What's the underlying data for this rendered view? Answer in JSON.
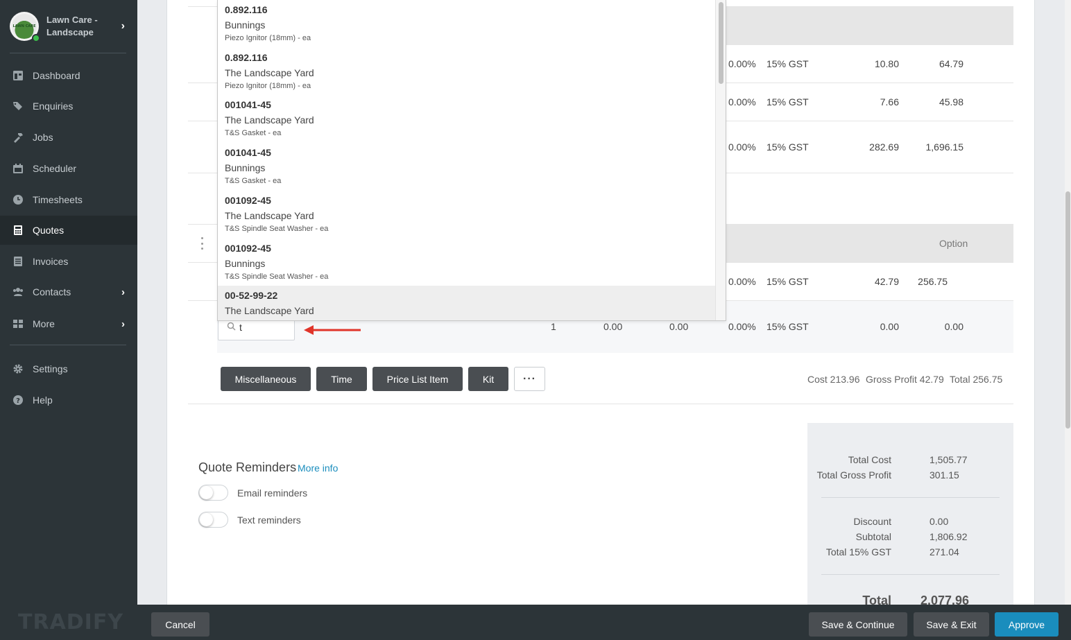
{
  "sidebar": {
    "brand": "Lawn Care - Landscape",
    "logo_text": "LAWN CARE",
    "items": [
      {
        "label": "Dashboard",
        "icon": "dashboard-icon"
      },
      {
        "label": "Enquiries",
        "icon": "tags-icon"
      },
      {
        "label": "Jobs",
        "icon": "hammer-icon"
      },
      {
        "label": "Scheduler",
        "icon": "calendar-icon"
      },
      {
        "label": "Timesheets",
        "icon": "clock-icon"
      },
      {
        "label": "Quotes",
        "icon": "calculator-icon",
        "active": true
      },
      {
        "label": "Invoices",
        "icon": "invoice-icon"
      },
      {
        "label": "Contacts",
        "icon": "users-icon"
      },
      {
        "label": "More",
        "icon": "grid-icon"
      },
      {
        "label": "Settings",
        "icon": "gear-icon"
      },
      {
        "label": "Help",
        "icon": "help-icon"
      }
    ],
    "footer_logo": "TRADIFY"
  },
  "table": {
    "rows": [
      {
        "discount": "0.00%",
        "tax": "15% GST",
        "tax_amount": "10.80",
        "amount": "64.79"
      },
      {
        "discount": "0.00%",
        "tax": "15% GST",
        "tax_amount": "7.66",
        "amount": "45.98"
      },
      {
        "discount": "0.00%",
        "tax": "15% GST",
        "tax_amount": "282.69",
        "amount": "1,696.15"
      }
    ],
    "group2_header_option": "Option",
    "group2_rows": [
      {
        "discount": "0.00%",
        "tax": "15% GST",
        "tax_amount": "42.79",
        "amount": "256.75"
      }
    ],
    "edit_row": {
      "search_value": "t",
      "qty": "1",
      "cost": "0.00",
      "price": "0.00",
      "discount": "0.00%",
      "tax": "15% GST",
      "tax_amount": "0.00",
      "amount": "0.00"
    }
  },
  "dropdown": {
    "items": [
      {
        "code": "0.892.116",
        "supplier": "Bunnings",
        "desc": "Piezo Ignitor (18mm) - ea"
      },
      {
        "code": "0.892.116",
        "supplier": "The Landscape Yard",
        "desc": "Piezo Ignitor (18mm) - ea"
      },
      {
        "code": "001041-45",
        "supplier": "The Landscape Yard",
        "desc": "T&S Gasket - ea"
      },
      {
        "code": "001041-45",
        "supplier": "Bunnings",
        "desc": "T&S Gasket - ea"
      },
      {
        "code": "001092-45",
        "supplier": "The Landscape Yard",
        "desc": "T&S Spindle Seat Washer - ea"
      },
      {
        "code": "001092-45",
        "supplier": "Bunnings",
        "desc": "T&S Spindle Seat Washer - ea"
      },
      {
        "code": "00-52-99-22",
        "supplier": "The Landscape Yard",
        "desc": ""
      }
    ]
  },
  "add_buttons": {
    "miscellaneous": "Miscellaneous",
    "time": "Time",
    "price_list_item": "Price List Item",
    "kit": "Kit",
    "more": "···"
  },
  "group_summary": {
    "cost": "Cost 213.96",
    "gross_profit": "Gross Profit 42.79",
    "total": "Total 256.75"
  },
  "reminders": {
    "title": "Quote Reminders",
    "more_info": "More info",
    "email_label": "Email reminders",
    "text_label": "Text reminders",
    "email_on": false,
    "text_on": false
  },
  "totals": {
    "total_cost_label": "Total Cost",
    "total_cost": "1,505.77",
    "total_gross_profit_label": "Total Gross Profit",
    "total_gross_profit": "301.15",
    "discount_label": "Discount",
    "discount": "0.00",
    "subtotal_label": "Subtotal",
    "subtotal": "1,806.92",
    "gst_label": "Total 15% GST",
    "gst": "271.04",
    "total_label": "Total",
    "total": "2,077.96"
  },
  "footer": {
    "cancel": "Cancel",
    "save_continue": "Save & Continue",
    "save_exit": "Save & Exit",
    "approve": "Approve"
  },
  "colors": {
    "sidebar_bg": "#2c3438",
    "accent": "#1a8dbd",
    "approve": "#1a8dbd",
    "arrow": "#e0342a"
  }
}
